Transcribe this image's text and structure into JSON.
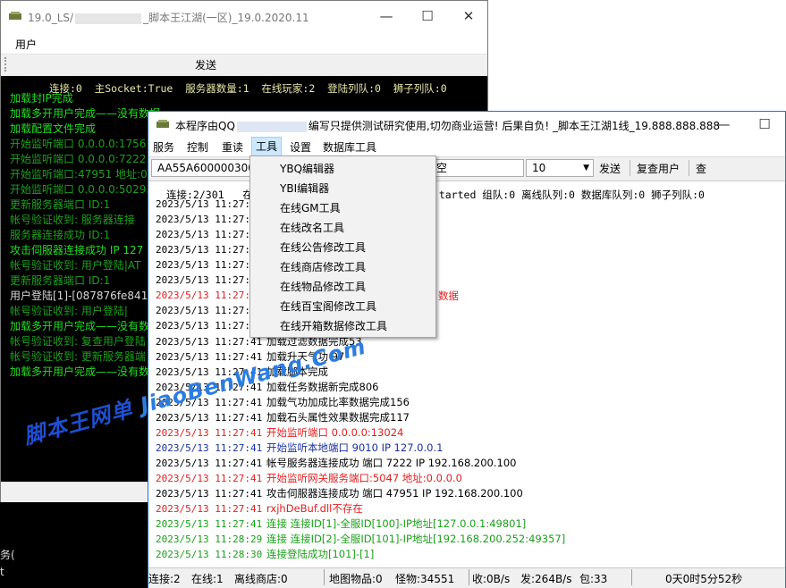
{
  "back_window": {
    "title_left": "19.0_LS/",
    "title_right": "_脚本王江湖(一区)_19.0.2020.11",
    "menu_user": "用户",
    "send_label": "发送",
    "status_line": "连接:0  主Socket:True  服务器数量:1  在线玩家:2  登陆列队:0  狮子列队:0",
    "log": [
      {
        "text": "加载封IP完成",
        "color": "g"
      },
      {
        "text": "加载多开用户完成——没有数据",
        "color": "g"
      },
      {
        "text": "加载配置文件完成",
        "color": "g"
      },
      {
        "text": "开始监听端口 0.0.0.0:1756",
        "color": "dg"
      },
      {
        "text": "开始监听端口 0.0.0.0:7222",
        "color": "dg"
      },
      {
        "text": "开始监听端口:47951 地址:0",
        "color": "dg"
      },
      {
        "text": "开始监听端口 0.0.0.0:50293",
        "color": "dg"
      },
      {
        "text": "更新服务器端口   ID:1",
        "color": "dg"
      },
      {
        "text": "帐号验证收到: 服务器连接",
        "color": "dg"
      },
      {
        "text": "服务器连接成功   ID:1",
        "color": "dg"
      },
      {
        "text": "攻击伺服器连接成功 IP 127",
        "color": "g"
      },
      {
        "text": "帐号验证收到: 用户登陆|AT",
        "color": "dg"
      },
      {
        "text": "更新服务器端口   ID:1",
        "color": "dg"
      },
      {
        "text": "用户登陆[1]-[087876fe841",
        "color": "wh"
      },
      {
        "text": "帐号验证收到: 用户登陆|",
        "color": "dg"
      },
      {
        "text": "加载多开用户完成——没有数",
        "color": "g"
      },
      {
        "text": "帐号验证收到: 复查用户登陆",
        "color": "dg"
      },
      {
        "text": "帐号验证收到: 更新服务器端",
        "color": "dg"
      },
      {
        "text": "加载多开用户完成——没有数",
        "color": "g"
      }
    ]
  },
  "fragments": {
    "a": "务(",
    "b": "t"
  },
  "front_window": {
    "title_left": "本程序由QQ",
    "title_right": "编写只提供测试研究使用,切勿商业运营! 后果自负! _脚本王江湖1线_19.888.888.888",
    "menu": [
      "服务",
      "控制",
      "重读",
      "工具",
      "设置",
      "数据库工具"
    ],
    "toolbar": {
      "left_value": "AA55A6000003006",
      "middle_value": "空",
      "count_value": "10",
      "send": "发送",
      "recheck": "复查用户",
      "search": "查"
    },
    "info_left": "连接:2/301",
    "info_left2": "在",
    "info_right": "tarted  组队:0  离线队列:0  数据库队列:0  狮子列队:0",
    "log": [
      {
        "ts": "2023/5/13  11:27:4",
        "msg": "",
        "color": "bk"
      },
      {
        "ts": "2023/5/13  11:27:4",
        "msg": "",
        "color": "bk"
      },
      {
        "ts": "2023/5/13  11:27:4",
        "msg": "",
        "color": "bk"
      },
      {
        "ts": "2023/5/13  11:27:4",
        "msg": "",
        "color": "bk"
      },
      {
        "ts": "2023/5/13  11:27:4",
        "msg": "",
        "color": "bk"
      },
      {
        "ts": "2023/5/13  11:27:4",
        "msg": "",
        "color": "bk"
      },
      {
        "ts": "2023/5/13  11:27:4",
        "msg": "",
        "color": "rd",
        "tail": "数据"
      },
      {
        "ts": "2023/5/13  11:27:4",
        "msg": "",
        "color": "bk"
      },
      {
        "ts": "2023/5/13  11:27:4",
        "msg": "",
        "color": "bk"
      },
      {
        "ts": "2023/5/13  11:27:41",
        "msg": "加载过滤数据完成53",
        "color": "bk"
      },
      {
        "ts": "2023/5/13  11:27:41",
        "msg": "加载升天气功  97",
        "color": "bk"
      },
      {
        "ts": "2023/5/13  11:27:41",
        "msg": "加载脚本完成",
        "color": "bk"
      },
      {
        "ts": "2023/5/13  11:27:41",
        "msg": "加载任务数据新完成806",
        "color": "bk"
      },
      {
        "ts": "2023/5/13  11:27:41",
        "msg": "加载气功加成比率数据完成156",
        "color": "bk"
      },
      {
        "ts": "2023/5/13  11:27:41",
        "msg": "加载石头属性效果数据完成117",
        "color": "bk"
      },
      {
        "ts": "2023/5/13  11:27:41",
        "msg": "开始监听端口 0.0.0.0:13024",
        "color": "rd"
      },
      {
        "ts": "2023/5/13  11:27:41",
        "msg": "开始监听本地端口  9010 IP 127.0.0.1",
        "color": "bl"
      },
      {
        "ts": "2023/5/13  11:27:41",
        "msg": "帐号服务器连接成功       端口       7222       IP       192.168.200.100",
        "color": "bk"
      },
      {
        "ts": "2023/5/13  11:27:41",
        "msg": "开始监听网关服务端口:5047 地址:0.0.0.0",
        "color": "rd"
      },
      {
        "ts": "2023/5/13  11:27:41",
        "msg": "攻击伺服器连接成功 端口 47951 IP 192.168.200.100",
        "color": "bk"
      },
      {
        "ts": "2023/5/13  11:27:41",
        "msg": "rxjhDeBuf.dll不存在",
        "color": "rd"
      },
      {
        "ts": "2023/5/13  11:27:41",
        "msg": "连接 连接ID[1]-全服ID[100]-IP地址[127.0.0.1:49801]",
        "color": "gr"
      },
      {
        "ts": "2023/5/13  11:28:29",
        "msg": "连接 连接ID[2]-全服ID[101]-IP地址[192.168.200.252:49357]",
        "color": "gr"
      },
      {
        "ts": "2023/5/13  11:28:30",
        "msg": "连接登陆成功[101]-[1]",
        "color": "gr"
      }
    ],
    "statusbar": {
      "conn": "连接:2",
      "online": "在线:1",
      "offline_shop": "离线商店:0",
      "map_items": "地图物品:0",
      "monsters": "怪物:34551",
      "recv": "收:0B/s",
      "send": "发:264B/s",
      "packets": "包:33",
      "uptime": "0天0时5分52秒"
    }
  },
  "tools_menu": [
    "YBQ编辑器",
    "YBI编辑器",
    "在线GM工具",
    "在线改名工具",
    "在线公告修改工具",
    "在线商店修改工具",
    "在线物品修改工具",
    "在线百宝阁修改工具",
    "在线开箱数据修改工具"
  ],
  "watermark": {
    "cn": "脚本王网单",
    "en": "JiaoBenWang.Com"
  }
}
